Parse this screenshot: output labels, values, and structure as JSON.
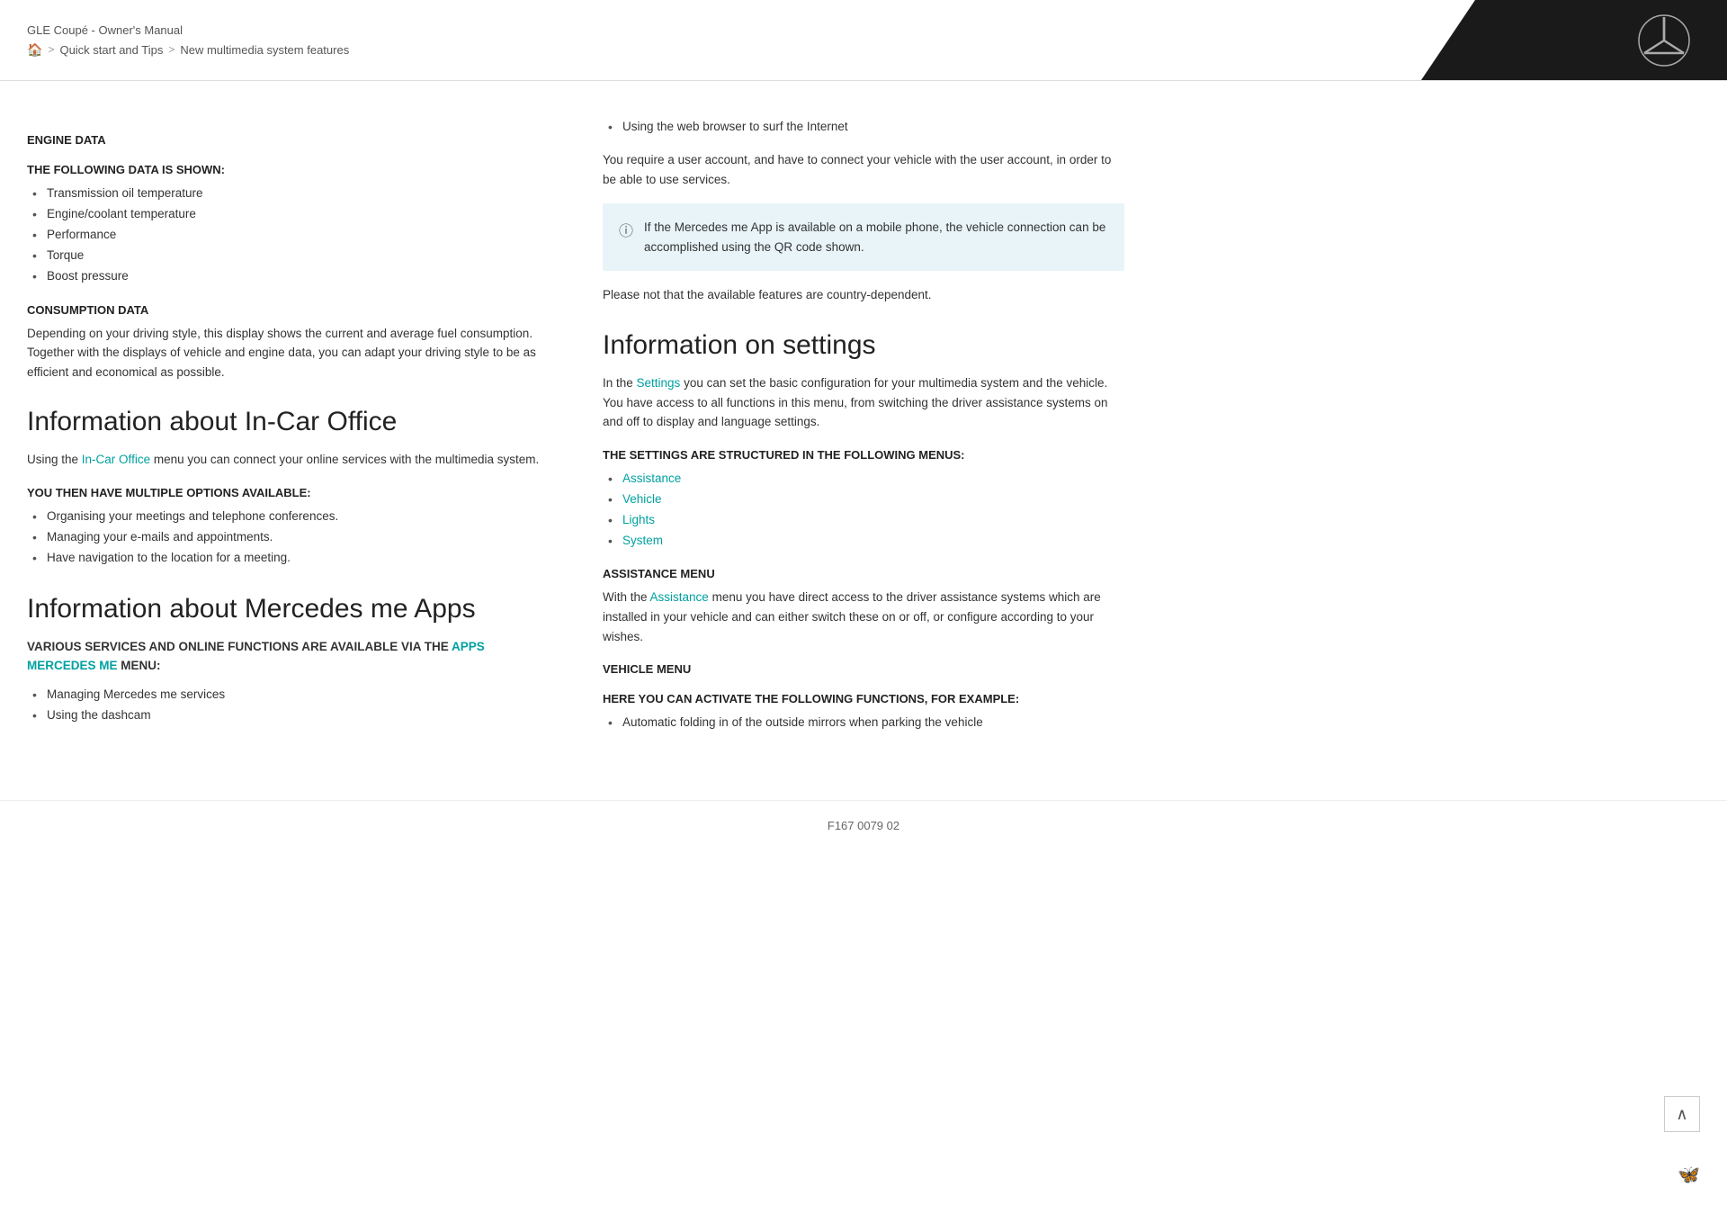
{
  "header": {
    "title": "GLE Coupé - Owner's Manual",
    "breadcrumb": {
      "home": "🏠",
      "sep1": ">",
      "step1": "Quick start and Tips",
      "sep2": ">",
      "step2": "New multimedia system features"
    }
  },
  "col_left": {
    "section1_heading": "ENGINE DATA",
    "section1_subheading": "THE FOLLOWING DATA IS SHOWN:",
    "section1_items": [
      "Transmission oil temperature",
      "Engine/coolant temperature",
      "Performance",
      "Torque",
      "Boost pressure"
    ],
    "section2_heading": "CONSUMPTION DATA",
    "section2_body": "Depending on your driving style, this display shows the current and average fuel consumption. Together with the displays of vehicle and engine data, you can adapt your driving style to be as efficient and economical as possible.",
    "h2_incar": "Information about In-Car Office",
    "incar_intro": "Using the",
    "incar_link": "In-Car Office",
    "incar_intro2": "menu you can connect your online services with the multimedia system.",
    "incar_subheading": "YOU THEN HAVE MULTIPLE OPTIONS AVAILABLE:",
    "incar_items": [
      "Organising your meetings and telephone conferences.",
      "Managing your e-mails and appointments.",
      "Have navigation to the location for a meeting."
    ],
    "h2_apps": "Information about Mercedes me Apps",
    "apps_subheading": "VARIOUS SERVICES AND ONLINE FUNCTIONS ARE AVAILABLE VIA THE",
    "apps_link": "APPS MERCEDES ME",
    "apps_subheading2": "MENU:",
    "apps_items": [
      "Managing Mercedes me services",
      "Using the dashcam"
    ]
  },
  "col_right": {
    "bullet_top": "Using the web browser to surf the Internet",
    "para1": "You require a user account, and have to connect your vehicle with the user account, in order to be able to use services.",
    "info_box_text": "If the Mercedes me App is available on a mobile phone, the vehicle connection can be accomplished using the QR code shown.",
    "para2": "Please not that the available features are country-dependent.",
    "h2_settings": "Information on settings",
    "settings_intro": "In the",
    "settings_link": "Settings",
    "settings_intro2": "you can set the basic configuration for your multimedia system and the vehicle. You have access to all functions in this menu, from switching the driver assistance systems on and off to display and language settings.",
    "settings_subheading": "THE SETTINGS ARE STRUCTURED IN THE FOLLOWING MENUS:",
    "settings_items": [
      "Assistance",
      "Vehicle",
      "Lights",
      "System"
    ],
    "assistance_heading": "ASSISTANCE MENU",
    "assistance_body_pre": "With the",
    "assistance_link": "Assistance",
    "assistance_body_post": "menu you have direct access to the driver assistance systems which are installed in your vehicle and can either switch these on or off, or configure according to your wishes.",
    "vehicle_heading": "VEHICLE MENU",
    "vehicle_subheading": "HERE YOU CAN ACTIVATE THE FOLLOWING FUNCTIONS, FOR EXAMPLE:",
    "vehicle_items": [
      "Automatic folding in of the outside mirrors when parking the vehicle"
    ]
  },
  "footer": {
    "code": "F167 0079 02"
  },
  "colors": {
    "link": "#00a0a0",
    "bg_info": "#e8f4f8",
    "header_dark": "#1a1a1a"
  }
}
